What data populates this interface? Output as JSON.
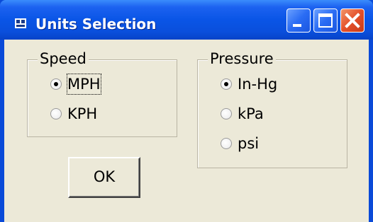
{
  "window": {
    "title": "Units Selection",
    "icon": "app-icon",
    "controls": [
      "minimize-icon",
      "maximize-icon",
      "close-icon"
    ]
  },
  "speed": {
    "label": "Speed",
    "options": [
      {
        "label": "MPH",
        "selected": true
      },
      {
        "label": "KPH",
        "selected": false
      }
    ]
  },
  "pressure": {
    "label": "Pressure",
    "options": [
      {
        "label": "In-Hg",
        "selected": true
      },
      {
        "label": "kPa",
        "selected": false
      },
      {
        "label": "psi",
        "selected": false
      }
    ]
  },
  "ok_label": "OK",
  "colors": {
    "titlebar": "#0a55e6",
    "client": "#ece9d8",
    "close": "#e4502a"
  }
}
